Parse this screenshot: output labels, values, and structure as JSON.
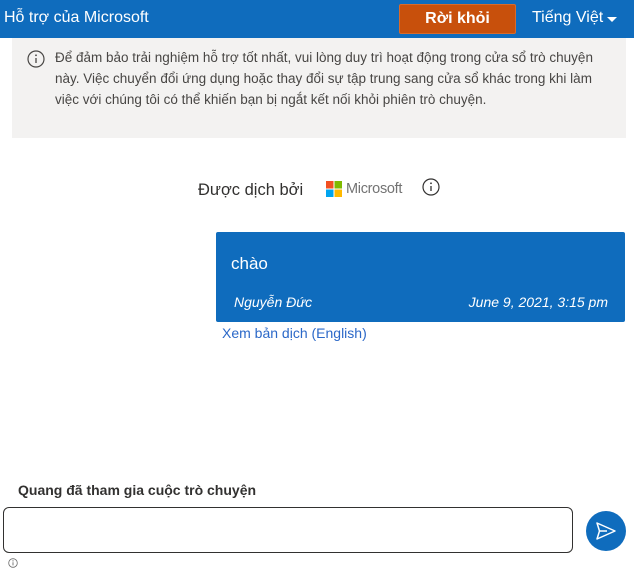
{
  "header": {
    "title": "Hỗ trợ của Microsoft",
    "leave_label": "Rời khỏi",
    "language_label": "Tiếng Việt",
    "background_color": "#0f6cbd",
    "leave_color": "#c8500c"
  },
  "notice": {
    "icon": "info-icon",
    "text": "Để đảm bảo trải nghiệm hỗ trợ tốt nhất, vui lòng duy trì hoạt động trong cửa sổ trò chuyện này. Việc chuyển đổi ứng dụng hoặc thay đổi sự tập trung sang cửa sổ khác trong khi làm việc với chúng tôi có thể khiến bạn bị ngắt kết nối khỏi phiên trò chuyện."
  },
  "translation": {
    "label": "Được dịch bởi",
    "provider": "Microsoft",
    "info_icon": "info-icon"
  },
  "message": {
    "text": "chào",
    "author": "Nguyễn Đức",
    "timestamp": "June 9, 2021, 3:15 pm",
    "view_translation_link": "Xem bản dịch (English)"
  },
  "status": {
    "joined_text": "Quang đã tham gia cuộc trò chuyện"
  },
  "composer": {
    "value": "",
    "placeholder": "",
    "send_icon": "send-icon"
  }
}
